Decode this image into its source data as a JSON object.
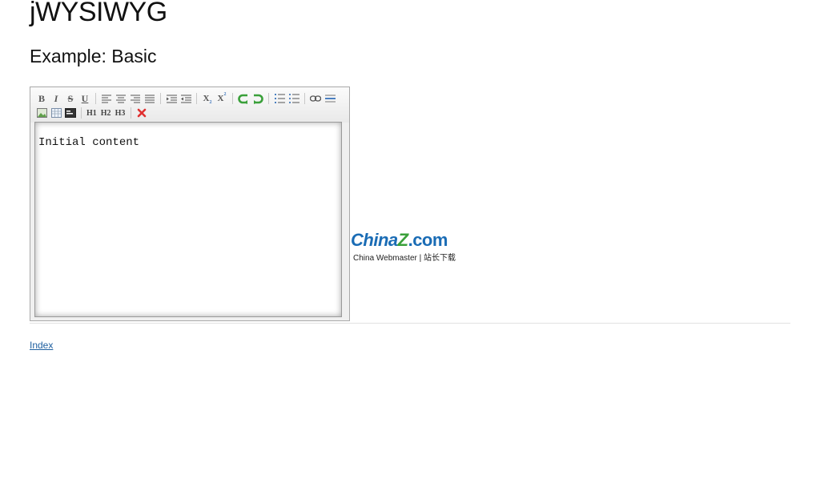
{
  "header": {
    "title": "jWYSIWYG",
    "subtitle": "Example: Basic"
  },
  "editor": {
    "content": "Initial content",
    "toolbar": {
      "bold": "B",
      "italic": "I",
      "strikethrough": "S",
      "underline": "U",
      "subscript": "X",
      "superscript": "X",
      "h1": "H1",
      "h2": "H2",
      "h3": "H3"
    }
  },
  "watermark": {
    "logo_china": "China",
    "logo_z": "Z",
    "logo_com": ".com",
    "tagline": "China Webmaster | 站长下载"
  },
  "footer": {
    "index_link": "Index"
  },
  "colors": {
    "link": "#2060a0",
    "logo_blue": "#1a6cb5",
    "logo_green": "#3aa03a",
    "undo_redo": "#3aa03a",
    "remove_format": "#e03030"
  }
}
